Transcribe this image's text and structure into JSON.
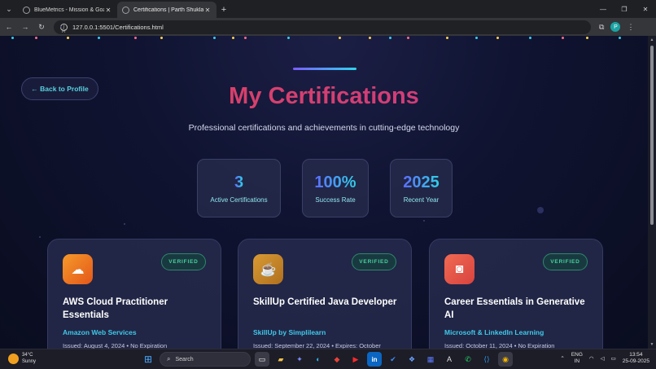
{
  "browser": {
    "tabs": [
      {
        "title": "BlueMetrics - Mission & Goals",
        "active": false
      },
      {
        "title": "Certifications | Parth Shukla",
        "active": true
      }
    ],
    "url": "127.0.0.1:5501/Certifications.html",
    "profile_initial": "P"
  },
  "page": {
    "back_label": "← Back to Profile",
    "title": "My Certifications",
    "subtitle": "Professional certifications and achievements in cutting-edge technology",
    "stats": [
      {
        "value": "3",
        "label": "Active Certifications"
      },
      {
        "value": "100%",
        "label": "Success Rate"
      },
      {
        "value": "2025",
        "label": "Recent Year"
      }
    ],
    "cards": [
      {
        "title": "AWS Cloud Practitioner Essentials",
        "issuer": "Amazon Web Services",
        "meta": "Issued: August 4, 2024 • No Expiration",
        "badge": "VERIFIED",
        "icon": "cloud-icon",
        "color": "#f07a1e"
      },
      {
        "title": "SkillUp Certified Java Developer",
        "issuer": "SkillUp by Simplilearn",
        "meta": "Issued: September 22, 2024 • Expires: October",
        "badge": "VERIFIED",
        "icon": "coffee-icon",
        "color": "#c98a2a"
      },
      {
        "title": "Career Essentials in Generative AI",
        "issuer": "Microsoft & LinkedIn Learning",
        "meta": "Issued: October 11, 2024 • No Expiration",
        "badge": "VERIFIED",
        "icon": "robot-icon",
        "color": "#e65a4e"
      }
    ]
  },
  "taskbar": {
    "temperature": "34°C",
    "condition": "Sunny",
    "search_placeholder": "Search",
    "lang_top": "ENG",
    "lang_bottom": "IN",
    "time": "13:54",
    "date": "25-09-2025"
  }
}
